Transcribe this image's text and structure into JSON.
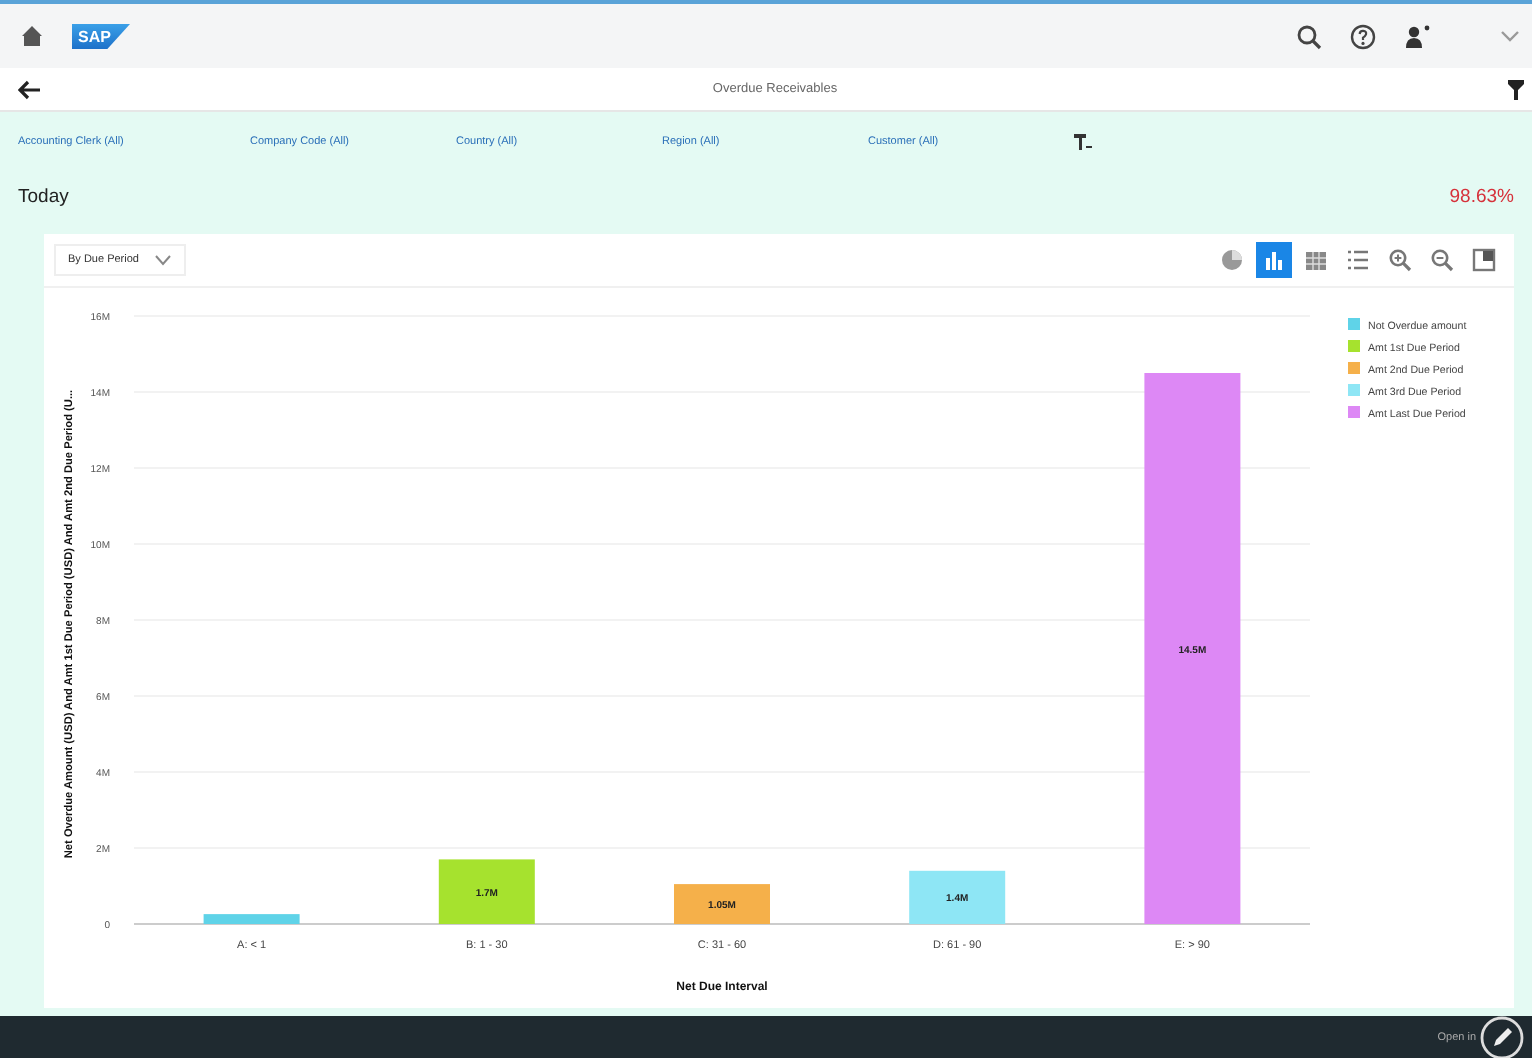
{
  "shell": {
    "logo": "SAP"
  },
  "page": {
    "title": "Overdue Receivables"
  },
  "filters": [
    {
      "label": "Accounting Clerk (All)"
    },
    {
      "label": "Company Code (All)"
    },
    {
      "label": "Country (All)"
    },
    {
      "label": "Region (All)"
    },
    {
      "label": "Customer (All)"
    }
  ],
  "kpi": {
    "label": "Today",
    "value": "98.63%"
  },
  "card": {
    "dropdown": "By Due Period",
    "tools": [
      {
        "kind": "pie",
        "selected": false
      },
      {
        "kind": "bar",
        "selected": true
      },
      {
        "kind": "table",
        "selected": false
      },
      {
        "kind": "list",
        "selected": false
      },
      {
        "kind": "zoom-in",
        "selected": false
      },
      {
        "kind": "zoom-out",
        "selected": false
      },
      {
        "kind": "fullscreen",
        "selected": false
      }
    ],
    "chart_data": {
      "type": "bar",
      "xlabel": "Net Due Interval",
      "ylabel": "Net Overdue Amount (USD) And Amt 1st Due Period (USD) And Amt 2nd Due Period (U...",
      "categories": [
        "A: < 1",
        "B: 1 - 30",
        "C: 31 - 60",
        "D: 61 - 90",
        "E: > 90"
      ],
      "grid": true,
      "legend": true,
      "ylim": [
        0,
        16000000
      ],
      "yticks": [
        {
          "value": 0,
          "label": "0"
        },
        {
          "value": 2000000,
          "label": "2M"
        },
        {
          "value": 4000000,
          "label": "4M"
        },
        {
          "value": 6000000,
          "label": "6M"
        },
        {
          "value": 8000000,
          "label": "8M"
        },
        {
          "value": 10000000,
          "label": "10M"
        },
        {
          "value": 12000000,
          "label": "12M"
        },
        {
          "value": 14000000,
          "label": "14M"
        },
        {
          "value": 16000000,
          "label": "16M"
        }
      ],
      "value_labels": [
        null,
        "1.7M",
        "1.05M",
        "1.4M",
        "14.5M"
      ],
      "series": [
        {
          "name": "Not Overdue amount",
          "color": "#5fd3e8",
          "values": [
            260000,
            null,
            null,
            null,
            null
          ]
        },
        {
          "name": "Amt 1st Due Period",
          "color": "#a6e22e",
          "values": [
            null,
            1700000,
            null,
            null,
            null
          ]
        },
        {
          "name": "Amt 2nd Due Period",
          "color": "#f5b04a",
          "values": [
            null,
            null,
            1050000,
            null,
            null
          ]
        },
        {
          "name": "Amt 3rd Due Period",
          "color": "#8ee6f5",
          "values": [
            null,
            null,
            null,
            1400000,
            null
          ]
        },
        {
          "name": "Amt Last Due Period",
          "color": "#dd88f5",
          "values": [
            null,
            null,
            null,
            null,
            14500000
          ]
        }
      ]
    }
  },
  "footer": {
    "label": "Open in"
  }
}
